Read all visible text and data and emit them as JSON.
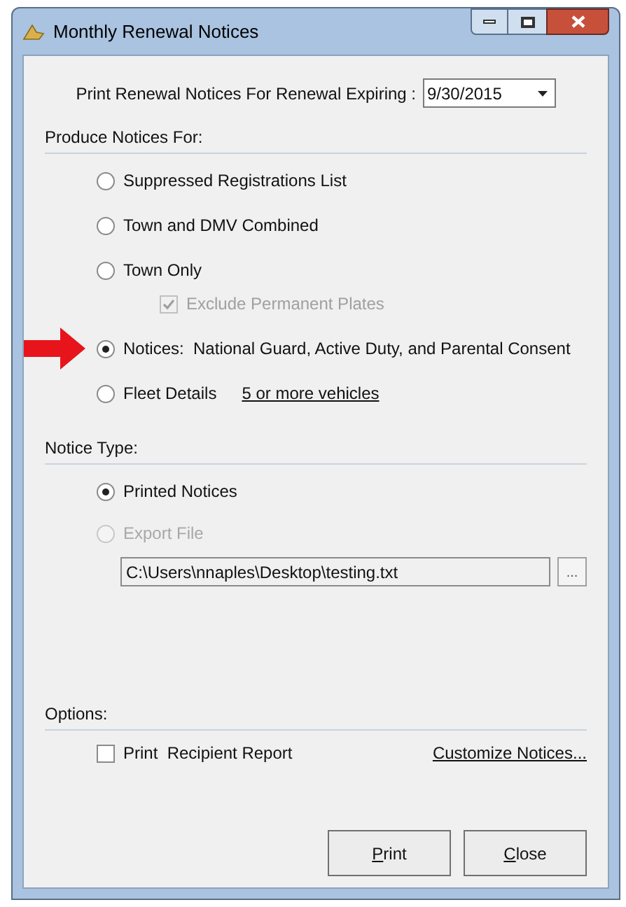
{
  "window": {
    "title": "Monthly Renewal Notices"
  },
  "expiring": {
    "label": "Print Renewal Notices For Renewal Expiring :",
    "value": "9/30/2015"
  },
  "produce_section": {
    "title": "Produce Notices For:",
    "options": [
      {
        "label": "Suppressed Registrations List",
        "selected": false,
        "highlighted": false
      },
      {
        "label": "Town and DMV Combined",
        "selected": false,
        "highlighted": false
      },
      {
        "label": "Town Only",
        "selected": false,
        "highlighted": false,
        "suboption": {
          "label": "Exclude Permanent Plates",
          "checked": true,
          "disabled": true
        }
      },
      {
        "label": "Notices:  National Guard, Active Duty, and Parental Consent",
        "selected": true,
        "highlighted": true
      },
      {
        "label": "Fleet Details",
        "selected": false,
        "highlighted": false,
        "link": "5 or more vehicles"
      }
    ]
  },
  "notice_type": {
    "title": "Notice Type:",
    "options": [
      {
        "label": "Printed Notices",
        "selected": true,
        "disabled": false
      },
      {
        "label": "Export File",
        "selected": false,
        "disabled": true
      }
    ],
    "path": "C:\\Users\\nnaples\\Desktop\\testing.txt",
    "browse_label": "..."
  },
  "options_section": {
    "title": "Options:",
    "checkbox": {
      "label": "Print  Recipient Report",
      "checked": false
    },
    "link": "Customize Notices..."
  },
  "buttons": [
    {
      "label": "Print",
      "mnemonic_first": true
    },
    {
      "label": "Close",
      "mnemonic_first": true
    }
  ]
}
